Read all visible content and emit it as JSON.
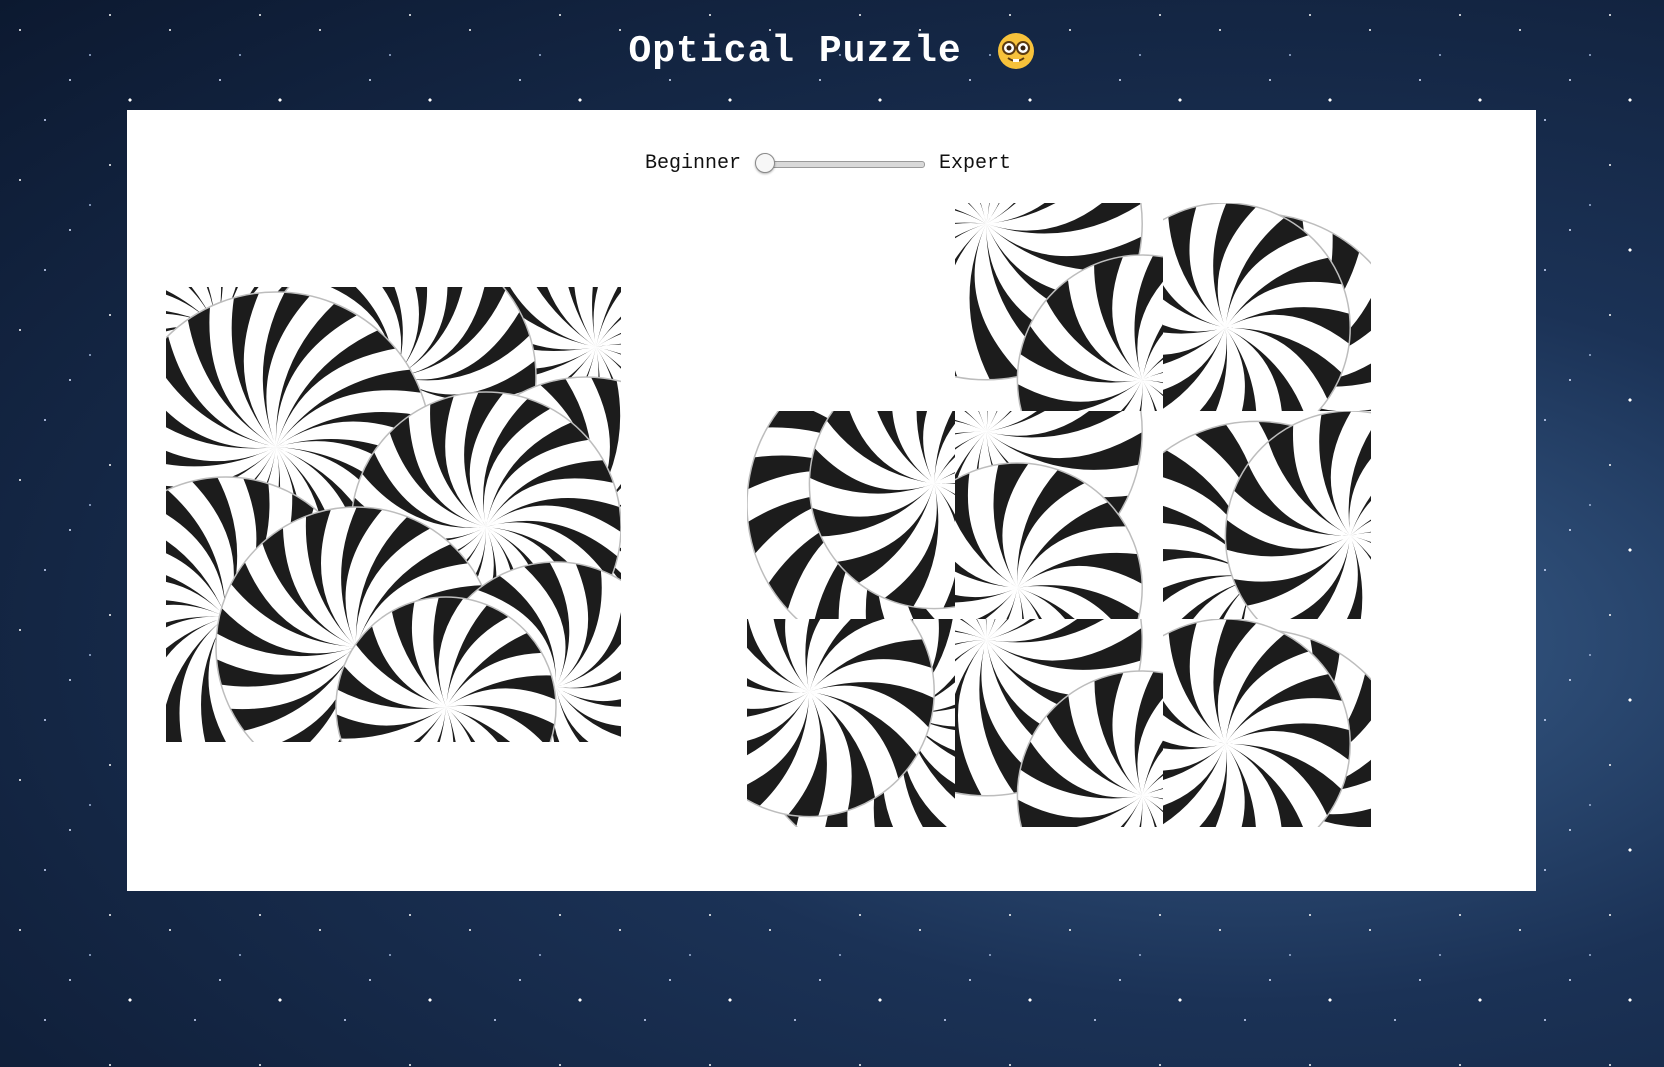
{
  "header": {
    "title": "Optical Puzzle",
    "emoji_icon": "nerd-face-icon"
  },
  "difficulty": {
    "min_label": "Beginner",
    "max_label": "Expert",
    "value": 0
  },
  "puzzle": {
    "grid_size": 3,
    "empty_slot": 0,
    "tiles": [
      {
        "slot": 1,
        "piece": "tile-a"
      },
      {
        "slot": 2,
        "piece": "tile-b"
      },
      {
        "slot": 3,
        "piece": "tile-c"
      },
      {
        "slot": 4,
        "piece": "tile-d"
      },
      {
        "slot": 5,
        "piece": "tile-e"
      },
      {
        "slot": 6,
        "piece": "tile-f"
      },
      {
        "slot": 7,
        "piece": "tile-g"
      },
      {
        "slot": 8,
        "piece": "tile-h"
      }
    ]
  },
  "colors": {
    "stripe_dark": "#1c1c1c",
    "stripe_light": "#ffffff",
    "panel": "#ffffff",
    "title": "#ffffff"
  }
}
